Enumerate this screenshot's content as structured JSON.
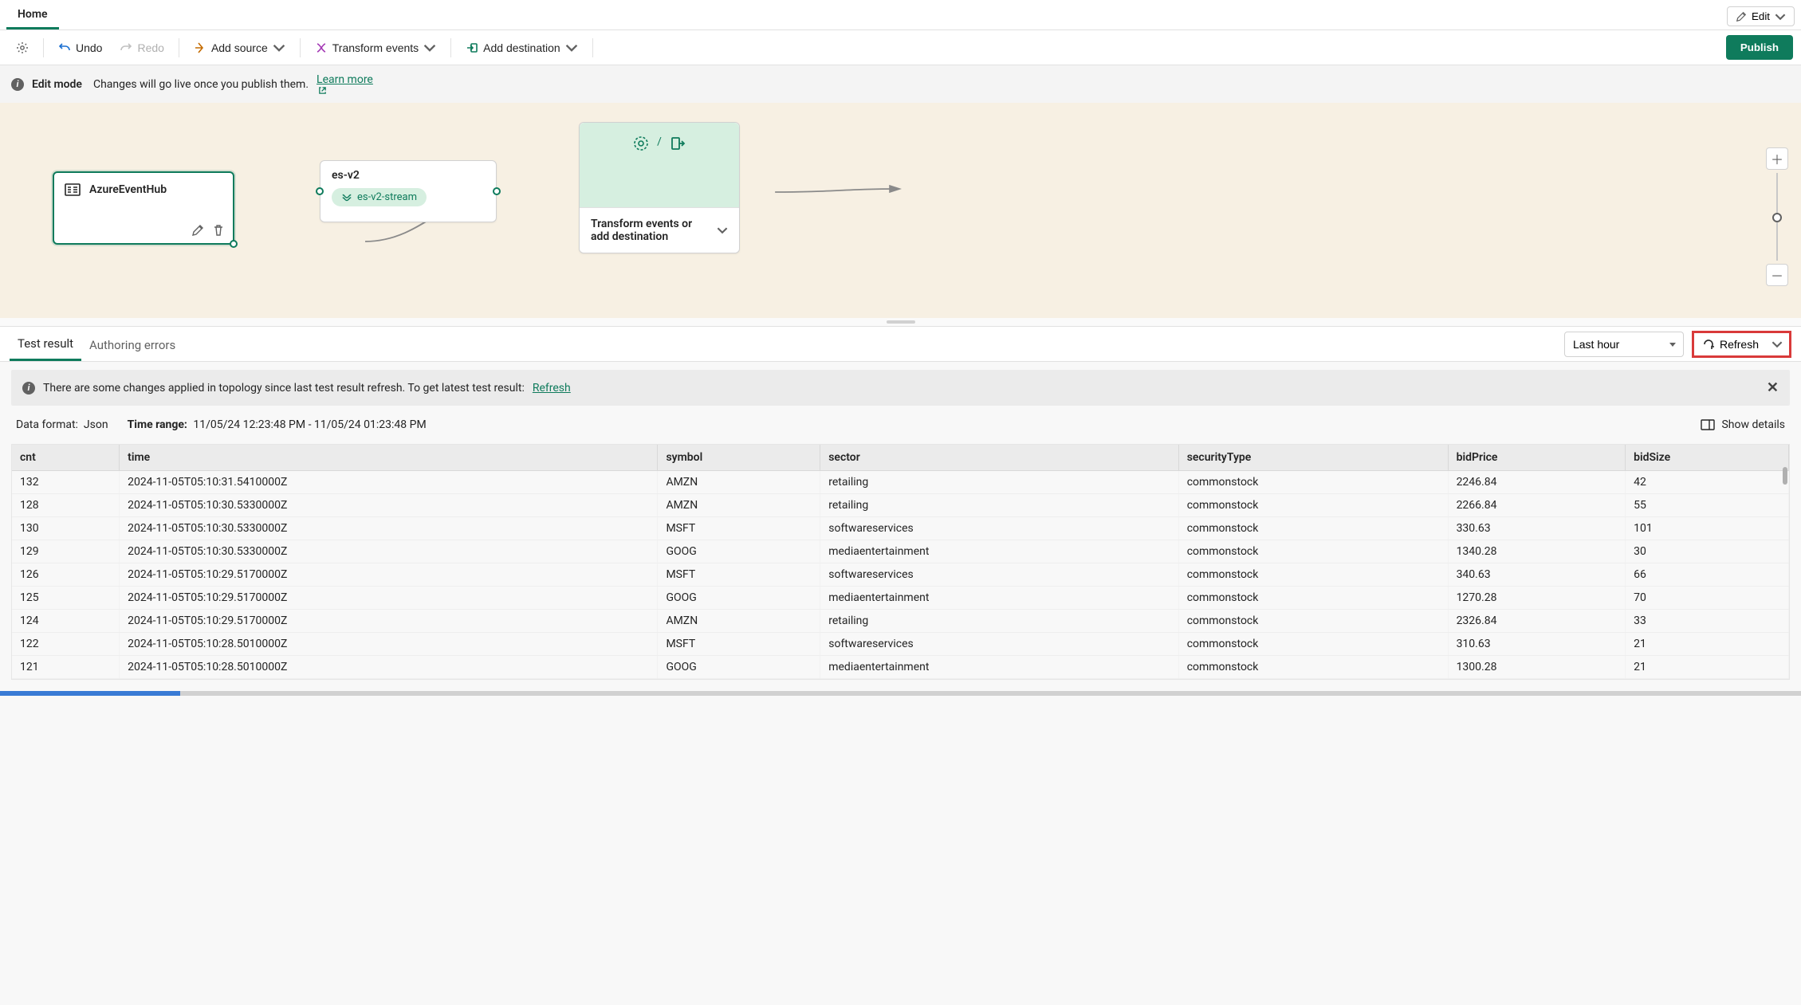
{
  "header": {
    "home_tab": "Home",
    "edit_label": "Edit"
  },
  "toolbar": {
    "undo": "Undo",
    "redo": "Redo",
    "add_source": "Add source",
    "transform_events": "Transform events",
    "add_destination": "Add destination",
    "publish": "Publish"
  },
  "edit_banner": {
    "title": "Edit mode",
    "message": "Changes will go live once you publish them.",
    "learn_more": "Learn more"
  },
  "canvas": {
    "source_node": {
      "title": "AzureEventHub"
    },
    "stream_node": {
      "title": "es-v2",
      "pill": "es-v2-stream"
    },
    "dest_node": {
      "prompt": "Transform events or add destination"
    }
  },
  "results": {
    "tabs": {
      "test_result": "Test result",
      "authoring_errors": "Authoring errors"
    },
    "time_range_selected": "Last hour",
    "refresh_label": "Refresh"
  },
  "change_banner": {
    "message": "There are some changes applied in topology since last test result refresh. To get latest test result:",
    "refresh_link": "Refresh"
  },
  "meta": {
    "data_format_label": "Data format:",
    "data_format_value": "Json",
    "time_range_label": "Time range:",
    "time_range_value": "11/05/24 12:23:48 PM - 11/05/24 01:23:48 PM",
    "show_details": "Show details"
  },
  "table": {
    "headers": [
      "cnt",
      "time",
      "symbol",
      "sector",
      "securityType",
      "bidPrice",
      "bidSize"
    ],
    "rows": [
      [
        "132",
        "2024-11-05T05:10:31.5410000Z",
        "AMZN",
        "retailing",
        "commonstock",
        "2246.84",
        "42"
      ],
      [
        "128",
        "2024-11-05T05:10:30.5330000Z",
        "AMZN",
        "retailing",
        "commonstock",
        "2266.84",
        "55"
      ],
      [
        "130",
        "2024-11-05T05:10:30.5330000Z",
        "MSFT",
        "softwareservices",
        "commonstock",
        "330.63",
        "101"
      ],
      [
        "129",
        "2024-11-05T05:10:30.5330000Z",
        "GOOG",
        "mediaentertainment",
        "commonstock",
        "1340.28",
        "30"
      ],
      [
        "126",
        "2024-11-05T05:10:29.5170000Z",
        "MSFT",
        "softwareservices",
        "commonstock",
        "340.63",
        "66"
      ],
      [
        "125",
        "2024-11-05T05:10:29.5170000Z",
        "GOOG",
        "mediaentertainment",
        "commonstock",
        "1270.28",
        "70"
      ],
      [
        "124",
        "2024-11-05T05:10:29.5170000Z",
        "AMZN",
        "retailing",
        "commonstock",
        "2326.84",
        "33"
      ],
      [
        "122",
        "2024-11-05T05:10:28.5010000Z",
        "MSFT",
        "softwareservices",
        "commonstock",
        "310.63",
        "21"
      ],
      [
        "121",
        "2024-11-05T05:10:28.5010000Z",
        "GOOG",
        "mediaentertainment",
        "commonstock",
        "1300.28",
        "21"
      ]
    ]
  }
}
